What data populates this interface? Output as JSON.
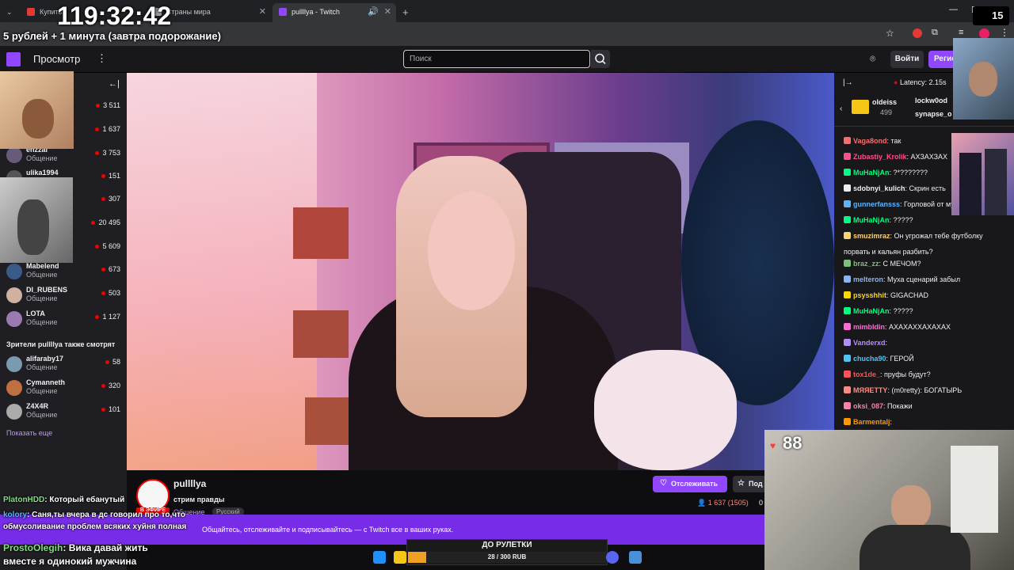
{
  "browser": {
    "tabs": [
      {
        "label": "Купить"
      },
      {
        "label": "Страны мира"
      },
      {
        "label": "pullllya - Twitch"
      }
    ],
    "new_tab": "+",
    "window_controls": [
      "—",
      "☐",
      "✕"
    ]
  },
  "overlay": {
    "timer": "119:32:42",
    "promo": "5 рублей + 1 минута (завтра подорожание)",
    "kick_viewers": "15",
    "heart_count": "88"
  },
  "topnav": {
    "browse": "Просмотр",
    "more": "⋮",
    "search_placeholder": "Поиск",
    "login": "Войти",
    "signup": "Регис"
  },
  "sidebar": {
    "collapse_icon": "←|",
    "followed": [
      {
        "name": "",
        "category": "",
        "viewers": "3 511",
        "avatar_color": "#c8a070"
      },
      {
        "name": "",
        "category": "",
        "viewers": "1 637",
        "avatar_color": "#8a6a50"
      },
      {
        "name": "enzzai",
        "category": "Общение",
        "viewers": "3 753",
        "avatar_color": "#6a5a7a"
      },
      {
        "name": "ulika1994",
        "category": "",
        "viewers": "151",
        "avatar_color": "#555"
      },
      {
        "name": "",
        "category": "",
        "viewers": "307",
        "avatar_color": "#444"
      },
      {
        "name": "",
        "category": "",
        "viewers": "20 495",
        "avatar_color": "#666"
      },
      {
        "name": "",
        "category": "",
        "viewers": "5 609",
        "avatar_color": "#777"
      },
      {
        "name": "Mabelend",
        "category": "Общение",
        "viewers": "673",
        "avatar_color": "#3a5a8a"
      },
      {
        "name": "DI_RUBENS",
        "category": "Общение",
        "viewers": "503",
        "avatar_color": "#d0b0a0"
      },
      {
        "name": "LOTA",
        "category": "Общение",
        "viewers": "1 127",
        "avatar_color": "#9a7ab0"
      }
    ],
    "also_watch_heading": "Зрители pullllya также смотрят",
    "also_watch": [
      {
        "name": "alifaraby17",
        "category": "Общение",
        "viewers": "58",
        "avatar_color": "#7a9ab0"
      },
      {
        "name": "Cymanneth",
        "category": "Общение",
        "viewers": "320",
        "avatar_color": "#c07040"
      },
      {
        "name": "Z4X4R",
        "category": "Общение",
        "viewers": "101",
        "avatar_color": "#aaa"
      }
    ],
    "show_more": "Показать еще"
  },
  "channel": {
    "name": "pullllya",
    "live_badge": "В ЭФИРЕ",
    "title": "стрим правды",
    "category": "Общение",
    "tag": "Русский",
    "follow": "Отслеживать",
    "subscribe": "Под",
    "viewers": "1 637 (1505)",
    "viewers_extra": "0"
  },
  "banner": {
    "text": "Общайтесь, отслеживайте и подписывайтесь — с Twitch все в ваших руках."
  },
  "chat": {
    "latency": "Latency: 2.15s",
    "expand_icon": "|→",
    "top_gifters": [
      {
        "name": "oldeiss",
        "count": "499"
      },
      {
        "name": "lockw0od",
        "count": ""
      },
      {
        "name": "synapse_o",
        "count": ""
      }
    ],
    "messages": [
      {
        "user": "Vaga8ond",
        "color": "#ff6b6b",
        "text": "так"
      },
      {
        "user": "Zubastiy_Krolik",
        "color": "#ff4f8b",
        "text": "АХЗАХЗАХ"
      },
      {
        "user": "MuHaNjAn",
        "color": "#00ff7f",
        "text": "?*???????"
      },
      {
        "user": "sdobnyi_kulich",
        "color": "#efeff1",
        "text": "Скрин есть"
      },
      {
        "user": "gunnerfansss",
        "color": "#5ab4ff",
        "text": "Горловой от му"
      },
      {
        "user": "MuHaNjAn",
        "color": "#00ff7f",
        "text": "?????"
      },
      {
        "user": "smuzimraz",
        "color": "#ffd36b",
        "text": "Он угрожал тебе футболку"
      },
      {
        "user": "",
        "color": "#efeff1",
        "text": "порвать и кальян разбить?"
      },
      {
        "user": "braz_zz",
        "color": "#7ac27a",
        "text": "С МЕЧОМ?"
      },
      {
        "user": "melteron",
        "color": "#8ab4f8",
        "text": "Муха сценарий забыл"
      },
      {
        "user": "psysshhit",
        "color": "#ffd700",
        "text": "GIGACHAD"
      },
      {
        "user": "MuHaNjAn",
        "color": "#00ff7f",
        "text": "?????"
      },
      {
        "user": "mimbldin",
        "color": "#ff6bd6",
        "text": "АХАХАХХАХАХАХ"
      },
      {
        "user": "Vanderxd",
        "color": "#b48cff",
        "text": ""
      },
      {
        "user": "chucha90",
        "color": "#4fc3f7",
        "text": "ГЕРОЙ"
      },
      {
        "user": "tox1de_",
        "color": "#ff5252",
        "text": "пруфы будут?"
      },
      {
        "user": "MЯЯETTY",
        "color": "#ff8a80",
        "text": "(m0retty): БОГАТЫРЬ"
      },
      {
        "user": "oksi_087",
        "color": "#ff80ab",
        "text": "Покажи"
      },
      {
        "user": "Barmentalj",
        "color": "#ff9800",
        "text": ""
      }
    ]
  },
  "overlay_chat": [
    {
      "user": "PlatonHDD",
      "text": "Который ебанутый",
      "color": "#7ee07e"
    },
    {
      "user": "kolory",
      "text": "Саня,ты вчера в дс говорил про то,что",
      "color": "#5ab4ff"
    },
    {
      "user": "",
      "text": "обмусоливание проблем всяких хуйня полная",
      "color": "#fff"
    },
    {
      "user": "ProstoOlegih",
      "text": "Вика давай жить",
      "color": "#7ee07e"
    },
    {
      "user": "",
      "text": "вместе я одинокий мужчина",
      "color": "#fff"
    }
  ],
  "roulette": {
    "title": "ДО РУЛЕТКИ",
    "progress_text": "28 / 300 RUB",
    "progress": 0.093
  }
}
